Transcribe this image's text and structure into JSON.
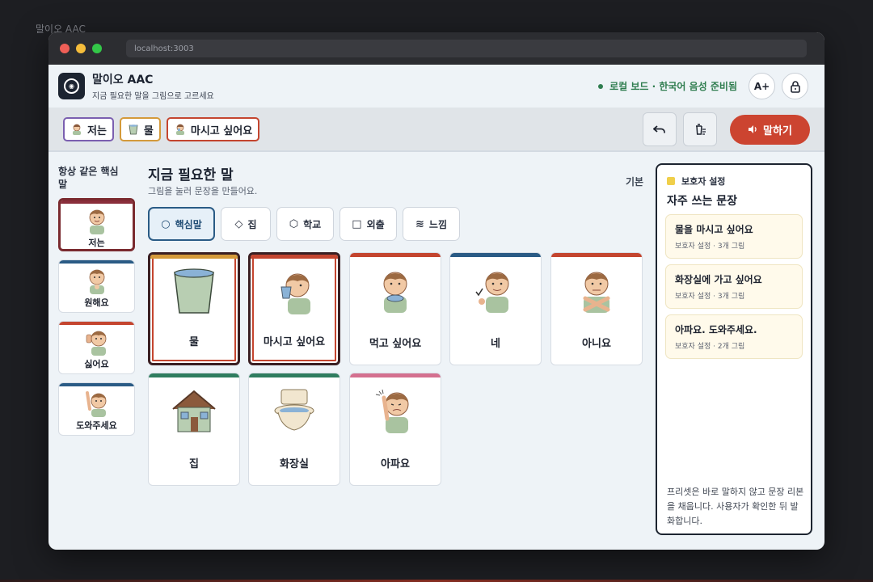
{
  "background_title": "말이오 AAC",
  "browser": {
    "url": "localhost:3003"
  },
  "header": {
    "title": "말이오 AAC",
    "subtitle": "지금 필요한 말을 그림으로 고르세요",
    "status": "로컬 보드 · 한국어 음성 준비됨",
    "font_button": "A+",
    "lock_icon": "lock-icon"
  },
  "sentence": {
    "chips": [
      {
        "label": "저는",
        "color": "#7b5fb0"
      },
      {
        "label": "물",
        "color": "#d49a3a"
      },
      {
        "label": "마시고 싶어요",
        "color": "#c4452f"
      }
    ],
    "undo_icon": "undo-icon",
    "clear_icon": "clear-icon",
    "speak_label": "말하기"
  },
  "core": {
    "title": "항상 같은 핵심말",
    "items": [
      {
        "label": "저는",
        "color": "#8a2e3b"
      },
      {
        "label": "원해요",
        "color": "#2a5b85"
      },
      {
        "label": "싫어요",
        "color": "#c4452f"
      },
      {
        "label": "도와주세요",
        "color": "#2a5b85"
      }
    ]
  },
  "main": {
    "title": "지금 필요한 말",
    "subtitle": "그림을 눌러 문장을 만들어요.",
    "mode_label": "기본",
    "tabs": [
      {
        "label": "핵심말",
        "icon": "circle-icon"
      },
      {
        "label": "집",
        "icon": "diamond-icon"
      },
      {
        "label": "학교",
        "icon": "hexagon-icon"
      },
      {
        "label": "외출",
        "icon": "square-icon"
      },
      {
        "label": "느낌",
        "icon": "waves-icon"
      }
    ],
    "cards": [
      {
        "label": "물",
        "color": "#d49a3a",
        "selected": true
      },
      {
        "label": "마시고 싶어요",
        "color": "#c4452f",
        "selected": true
      },
      {
        "label": "먹고 싶어요",
        "color": "#c4452f",
        "selected": false
      },
      {
        "label": "네",
        "color": "#2a5b85",
        "selected": false
      },
      {
        "label": "아니요",
        "color": "#c4452f",
        "selected": false
      },
      {
        "label": "집",
        "color": "#2f7d5f",
        "selected": false
      },
      {
        "label": "화장실",
        "color": "#2f7d5f",
        "selected": false
      },
      {
        "label": "아파요",
        "color": "#d4708f",
        "selected": false
      }
    ]
  },
  "guardian": {
    "tag": "보호자 설정",
    "title": "자주 쓰는 문장",
    "presets": [
      {
        "title": "물을 마시고 싶어요",
        "meta": "보호자 설정 · 3개 그림"
      },
      {
        "title": "화장실에 가고 싶어요",
        "meta": "보호자 설정 · 3개 그림"
      },
      {
        "title": "아파요. 도와주세요.",
        "meta": "보호자 설정 · 2개 그림"
      }
    ],
    "note": "프리셋은 바로 말하지 않고 문장 리본을 채웁니다. 사용자가 확인한 뒤 발화합니다."
  }
}
